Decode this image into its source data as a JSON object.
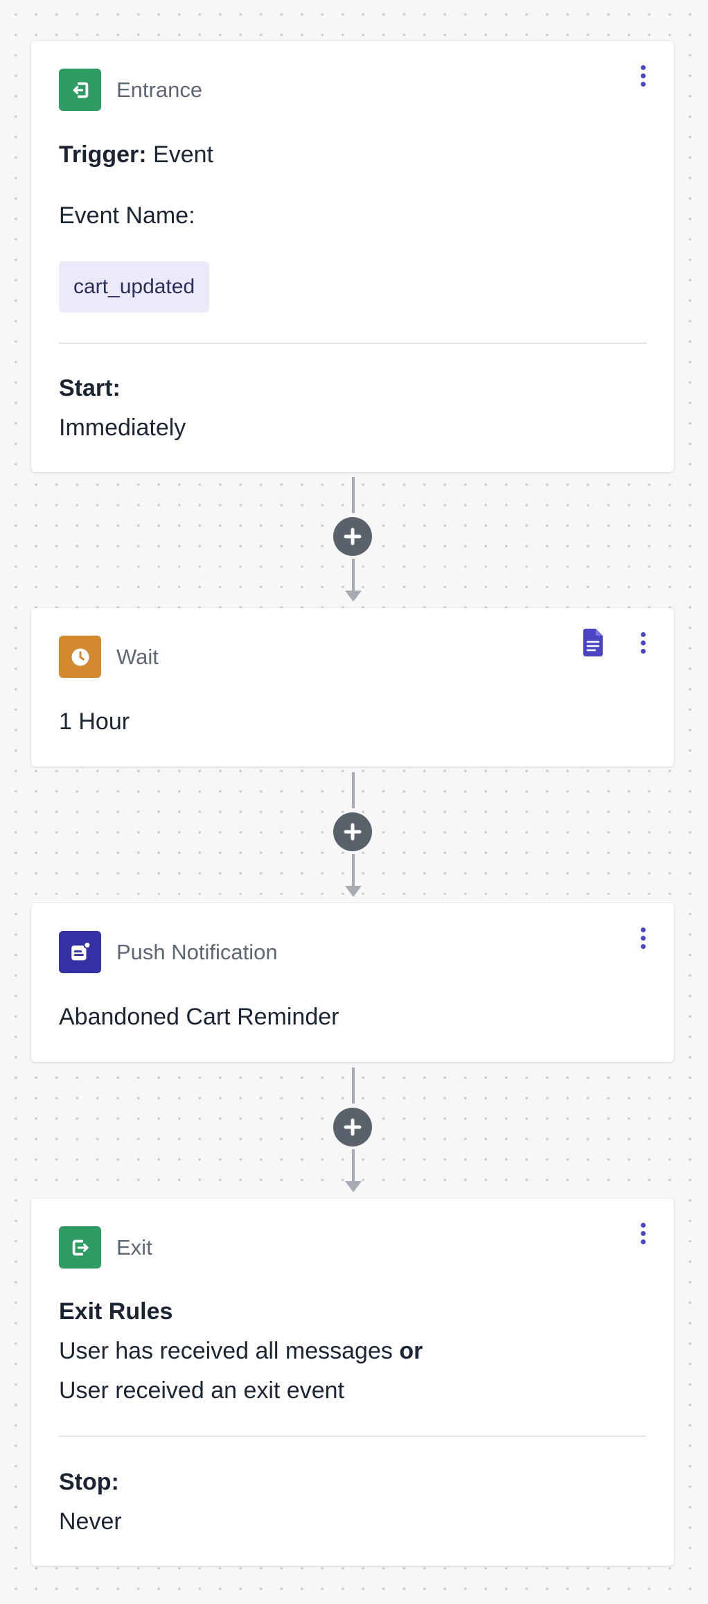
{
  "entrance": {
    "type_label": "Entrance",
    "trigger_label": "Trigger:",
    "trigger_value": " Event",
    "event_name_label": "Event Name:",
    "event_name_value": "cart_updated",
    "start_label": "Start:",
    "start_value": "Immediately",
    "icon": "entrance-icon",
    "color": "#2e9b62"
  },
  "wait": {
    "type_label": "Wait",
    "value": "1 Hour",
    "icon": "clock-icon",
    "color": "#d4892e"
  },
  "push": {
    "type_label": "Push Notification",
    "value": "Abandoned Cart Reminder",
    "icon": "push-notification-icon",
    "color": "#3431a4"
  },
  "exit": {
    "type_label": "Exit",
    "rules_label": "Exit Rules",
    "rule_1": "User has received all messages ",
    "rule_joiner": "or",
    "rule_2": "User received an exit event",
    "stop_label": "Stop:",
    "stop_value": "Never",
    "icon": "exit-icon",
    "color": "#2e9b62"
  },
  "colors": {
    "accent": "#4b45c6",
    "connector": "#a9abb2",
    "add_button": "#5b616b"
  }
}
